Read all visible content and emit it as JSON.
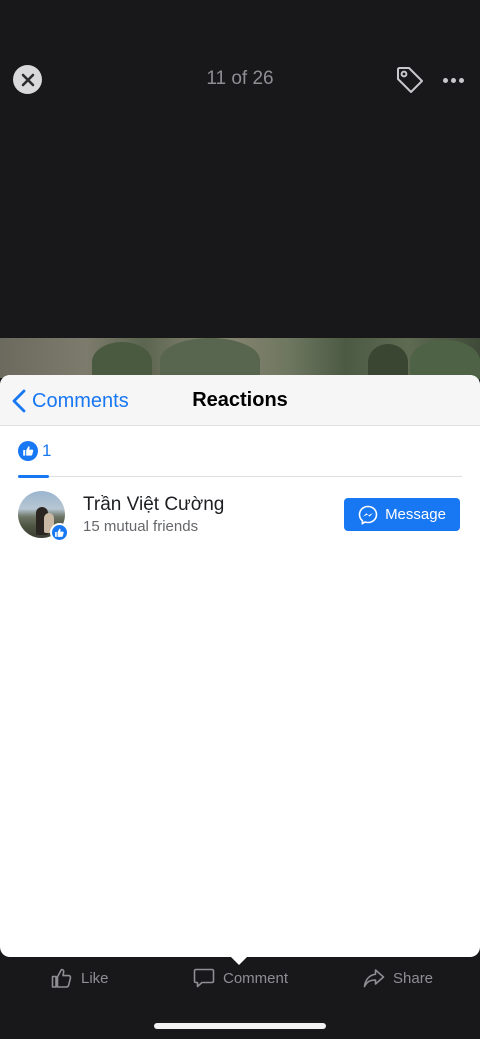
{
  "viewer": {
    "counter": "11 of 26",
    "close_icon": "close-icon",
    "tag_icon": "tag-icon",
    "more_icon": "more-icon"
  },
  "sheet": {
    "back_label": "Comments",
    "title": "Reactions",
    "tabs": [
      {
        "icon": "like-icon",
        "count": "1",
        "selected": true
      }
    ],
    "reactors": [
      {
        "name": "Trần Việt Cường",
        "subtitle": "15 mutual friends",
        "reaction": "like",
        "button_label": "Message",
        "button_icon": "messenger-icon"
      }
    ]
  },
  "actions": {
    "like": "Like",
    "comment": "Comment",
    "share": "Share"
  },
  "colors": {
    "accent": "#1877f2",
    "viewer_bg": "#18181a",
    "muted": "#8e8e93"
  }
}
